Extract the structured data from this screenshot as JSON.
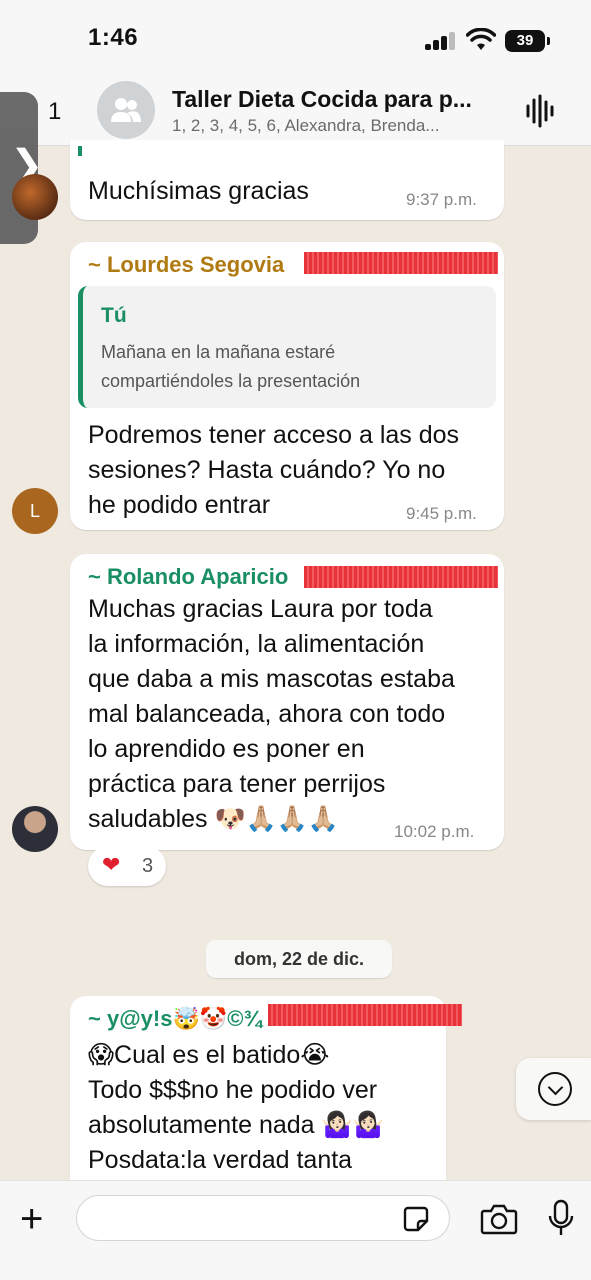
{
  "status_bar": {
    "time": "1:46",
    "battery": "39"
  },
  "header": {
    "back_count": "1",
    "title": "Taller Dieta Cocida para p...",
    "subtitle": "1, 2, 3, 4, 5, 6, Alexandra, Brenda..."
  },
  "messages": {
    "m1": {
      "text": "Muchísimas gracias",
      "time": "9:37 p.m."
    },
    "m2": {
      "sender": "~ Lourdes Segovia",
      "sender_color": "#b07a12",
      "avatar_letter": "L",
      "quote_author": "Tú",
      "quote_line1": "Mañana en la mañana estaré",
      "quote_line2": "compartiéndoles la presentación",
      "line1": "Podremos tener acceso a las dos",
      "line2": "sesiones? Hasta cuándo? Yo no",
      "line3": "he podido entrar",
      "time": "9:45 p.m."
    },
    "m3": {
      "sender": "~ Rolando Aparicio",
      "sender_color": "#1a8f63",
      "line1": "Muchas gracias Laura por toda",
      "line2": "la información, la alimentación",
      "line3": "que daba a mis mascotas estaba",
      "line4": "mal balanceada, ahora con todo",
      "line5": "lo aprendido es poner en",
      "line6": "práctica para tener perrijos",
      "line7": "saludables 🐶🙏🏼🙏🏼🙏🏼",
      "time": "10:02 p.m.",
      "reaction_emoji": "❤",
      "reaction_count": "3"
    },
    "date_divider": "dom, 22 de dic.",
    "m4": {
      "sender": "~ y@y!s🤯🤡©¾",
      "sender_color": "#1a8f63",
      "line1": "😱Cual es el batido😭",
      "line2": "Todo $$$no he podido ver",
      "line3": "absolutamente nada 🤷🏻‍♀️🤷🏻‍♀️",
      "line4": "Posdata:la verdad tanta"
    }
  },
  "composer": {
    "placeholder": ""
  }
}
